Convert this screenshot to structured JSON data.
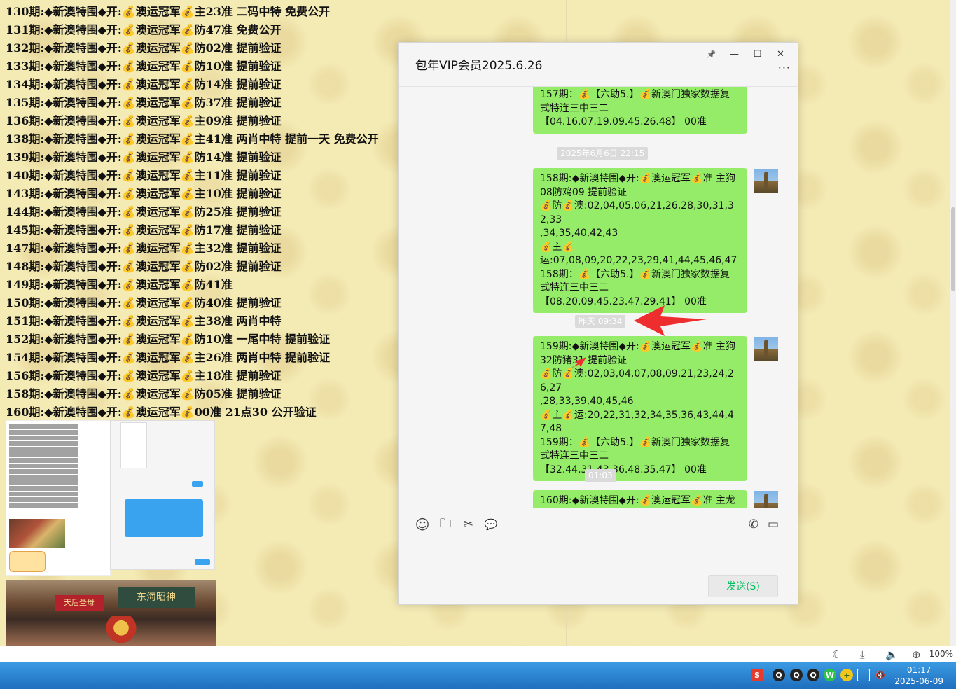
{
  "page": {
    "lines": [
      "130期:◆新澳特围◆开:💰澳运冠军💰主23准  二码中特  免费公开",
      "131期:◆新澳特围◆开:💰澳运冠军💰防47准  免费公开",
      "132期:◆新澳特围◆开:💰澳运冠军💰防02准  提前验证",
      "133期:◆新澳特围◆开:💰澳运冠军💰防10准  提前验证",
      "134期:◆新澳特围◆开:💰澳运冠军💰防14准  提前验证",
      "135期:◆新澳特围◆开:💰澳运冠军💰防37准  提前验证",
      "136期:◆新澳特围◆开:💰澳运冠军💰主09准  提前验证",
      "138期:◆新澳特围◆开:💰澳运冠军💰主41准  两肖中特  提前一天  免费公开",
      "139期:◆新澳特围◆开:💰澳运冠军💰防14准  提前验证",
      "140期:◆新澳特围◆开:💰澳运冠军💰主11准  提前验证",
      "143期:◆新澳特围◆开:💰澳运冠军💰主10准  提前验证",
      "144期:◆新澳特围◆开:💰澳运冠军💰防25准  提前验证",
      "145期:◆新澳特围◆开:💰澳运冠军💰防17准  提前验证",
      "147期:◆新澳特围◆开:💰澳运冠军💰主32准  提前验证",
      "148期:◆新澳特围◆开:💰澳运冠军💰防02准  提前验证",
      "149期:◆新澳特围◆开:💰澳运冠军💰防41准",
      "150期:◆新澳特围◆开:💰澳运冠军💰防40准  提前验证",
      "151期:◆新澳特围◆开:💰澳运冠军💰主38准  两肖中特",
      "152期:◆新澳特围◆开:💰澳运冠军💰防10准  一尾中特  提前验证",
      "154期:◆新澳特围◆开:💰澳运冠军💰主26准  两肖中特  提前验证",
      "156期:◆新澳特围◆开:💰澳运冠军💰主18准  提前验证",
      "158期:◆新澳特围◆开:💰澳运冠军💰防05准  提前验证",
      "160期:◆新澳特围◆开:💰澳运冠军💰00准  21点30  公开验证"
    ],
    "banner_main": "东海昭神",
    "banner_small": "天后圣母"
  },
  "chat": {
    "title": "包年VIP会员2025.6.26",
    "controls": {
      "pin": "📌",
      "min": "—",
      "max": "☐",
      "close": "✕"
    },
    "more": "···",
    "msg1": [
      "157期：💰【六助5.】💰新澳门独家数据复",
      "式特连三中三二",
      "【04.16.07.19.09.45.26.48】 00准"
    ],
    "time1": "2025年6月6日 22:15",
    "msg2": [
      "158期:◆新澳特围◆开:💰澳运冠军💰准 主狗",
      "08防鸡09 提前验证",
      "💰防💰澳:02,04,05,06,21,26,28,30,31,32,33",
      ",34,35,40,42,43",
      "💰主💰",
      "运:07,08,09,20,22,23,29,41,44,45,46,47",
      "158期：💰【六助5.】💰新澳门独家数据复",
      "式特连三中三二",
      "【08.20.09.45.23.47.29.41】 00准"
    ],
    "time2": "昨天 09:34",
    "msg3": [
      "159期:◆新澳特围◆开:💰澳运冠军💰准 主狗",
      "32防猪31 提前验证",
      "💰防💰澳:02,03,04,07,08,09,21,23,24,26,27",
      ",28,33,39,40,45,46",
      "💰主💰运:20,22,31,32,34,35,36,43,44,47,48",
      "159期：💰【六助5.】💰新澳门独家数据复",
      "式特连三中三二",
      "【32.44.31.43.36.48.35.47】 00准"
    ],
    "time3": "01:03",
    "msg4": [
      "160期:◆新澳特围◆开:💰澳运冠军💰准 主龙"
    ],
    "send_label": "发送(S)",
    "tools": {
      "emoji": "☺",
      "folder": "🗀",
      "scissors": "✂",
      "chat": "💬",
      "phone": "✆",
      "video": "▭"
    }
  },
  "statusbar": {
    "zoom": "100%"
  },
  "taskbar": {
    "time": "01:17",
    "date": "2025-06-09"
  }
}
